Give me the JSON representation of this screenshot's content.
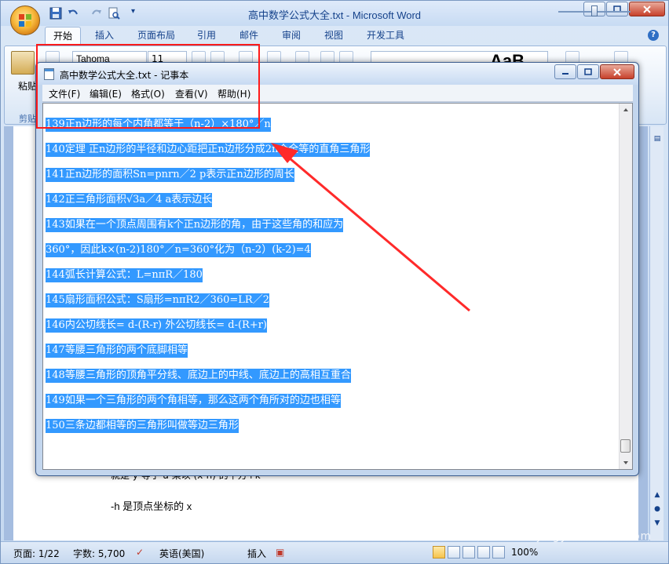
{
  "word": {
    "title": "高中数学公式大全.txt - Microsoft Word",
    "tabs": [
      "开始",
      "插入",
      "页面布局",
      "引用",
      "邮件",
      "审阅",
      "视图",
      "开发工具"
    ],
    "ribbon": {
      "paste_label": "粘贴",
      "clipboard_group": "剪贴",
      "font_name": "Tahoma",
      "font_size": "11",
      "style_sample": "AaB"
    },
    "doc_lines": [
      "就是 y 等于 a 乘以 (x-h) 的平方+k",
      "-h 是顶点坐标的 x"
    ],
    "status": {
      "page": "页面: 1/22",
      "words": "字数: 5,700",
      "language": "英语(美国)",
      "insert": "插入",
      "zoom": "100%"
    }
  },
  "notepad": {
    "title": "高中数学公式大全.txt - 记事本",
    "menus": [
      "文件(F)",
      "编辑(E)",
      "格式(O)",
      "查看(V)",
      "帮助(H)"
    ],
    "lines": [
      "139正n边形的每个内角都等于（n-2）×180°／n",
      "140定理 正n边形的半径和边心距把正n边形分成2n个全等的直角三角形",
      "141正n边形的面积Sn=pnrn／2 p表示正n边形的周长",
      "142正三角形面积√3a／4 a表示边长",
      "143如果在一个顶点周围有k个正n边形的角，由于这些角的和应为",
      "360°，因此k×(n-2)180°／n=360°化为（n-2）(k-2)=4",
      "144弧长计算公式：L=nπR／180",
      "145扇形面积公式：S扇形=nπR2／360=LR／2",
      "146内公切线长= d-(R-r) 外公切线长= d-(R+r)",
      "147等腰三角形的两个底脚相等",
      "148等腰三角形的顶角平分线、底边上的中线、底边上的高相互重合",
      "149如果一个三角形的两个角相等，那么这两个角所对的边也相等",
      "150三条边都相等的三角形叫做等边三角形"
    ]
  },
  "watermark": {
    "logo": "Bai经验",
    "url": "jingyan.baidu.com"
  },
  "colors": {
    "selection": "#3399ff",
    "annotation": "#ff1a1a"
  }
}
